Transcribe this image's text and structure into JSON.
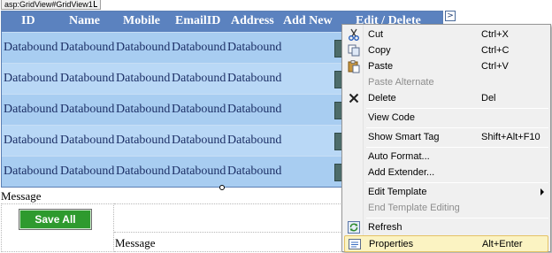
{
  "designer": {
    "control_tag": "asp:GridView#GridView1",
    "smart_tag_glyph": ">",
    "grid": {
      "columns": [
        "ID",
        "Name",
        "Mobile",
        "EmailID",
        "Address",
        "Add New",
        "Edit / Delete"
      ],
      "rows": [
        [
          "Databound",
          "Databound",
          "Databound",
          "Databound",
          "Databound"
        ],
        [
          "Databound",
          "Databound",
          "Databound",
          "Databound",
          "Databound"
        ],
        [
          "Databound",
          "Databound",
          "Databound",
          "Databound",
          "Databound"
        ],
        [
          "Databound",
          "Databound",
          "Databound",
          "Databound",
          "Databound"
        ],
        [
          "Databound",
          "Databound",
          "Databound",
          "Databound",
          "Databound"
        ]
      ]
    },
    "message_label_1": "Message",
    "save_button_label": "Save All",
    "message_label_2": "Message"
  },
  "context_menu": {
    "items": [
      {
        "label": "Cut",
        "shortcut": "Ctrl+X",
        "icon": "scissors-icon"
      },
      {
        "label": "Copy",
        "shortcut": "Ctrl+C",
        "icon": "copy-icon"
      },
      {
        "label": "Paste",
        "shortcut": "Ctrl+V",
        "icon": "paste-icon"
      },
      {
        "label": "Paste Alternate",
        "shortcut": "",
        "disabled": true
      },
      {
        "label": "Delete",
        "shortcut": "Del",
        "icon": "delete-icon"
      },
      {
        "label": "View Code",
        "shortcut": ""
      },
      {
        "label": "Show Smart Tag",
        "shortcut": "Shift+Alt+F10"
      },
      {
        "label": "Auto Format...",
        "shortcut": ""
      },
      {
        "label": "Add Extender...",
        "shortcut": ""
      },
      {
        "label": "Edit Template",
        "shortcut": "",
        "submenu": true
      },
      {
        "label": "End Template Editing",
        "shortcut": "",
        "disabled": true
      },
      {
        "label": "Refresh",
        "shortcut": "",
        "icon": "refresh-icon"
      },
      {
        "label": "Properties",
        "shortcut": "Alt+Enter",
        "icon": "properties-icon",
        "highlighted": true
      }
    ]
  },
  "colors": {
    "grid_header": "#5b82bf",
    "grid_row_odd": "#a8cdf1",
    "grid_row_even": "#b9d8f6",
    "save_button": "#2e9a2e",
    "menu_highlight": "#fbf3c2"
  }
}
